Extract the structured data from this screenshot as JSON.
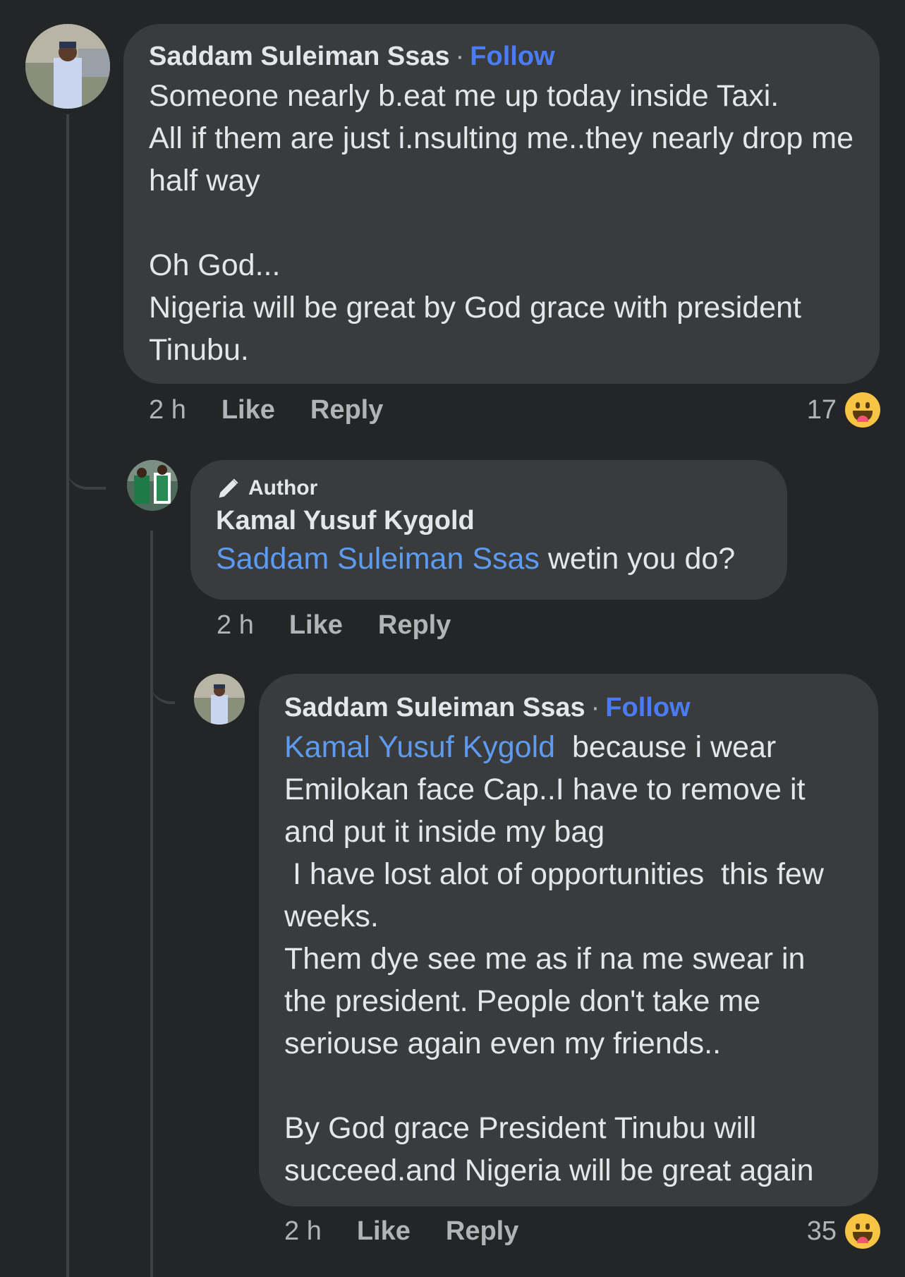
{
  "comments": [
    {
      "author": "Saddam Suleiman Ssas",
      "separator": "·",
      "follow_label": "Follow",
      "text": "Someone nearly b.eat me up today inside Taxi.\nAll if them are just i.nsulting me..they nearly drop me half way\n\nOh God...\nNigeria will be great by God grace with president Tinubu.",
      "time": "2 h",
      "like_label": "Like",
      "reply_label": "Reply",
      "reaction_count": "17",
      "reaction_icon": "laughing-emoji-icon"
    },
    {
      "badge_label": "Author",
      "badge_icon": "pencil-icon",
      "author": "Kamal Yusuf Kygold",
      "mention": "Saddam Suleiman Ssas",
      "text": " wetin you do?",
      "time": "2 h",
      "like_label": "Like",
      "reply_label": "Reply"
    },
    {
      "author": "Saddam Suleiman Ssas",
      "separator": "·",
      "follow_label": "Follow",
      "mention": "Kamal Yusuf Kygold",
      "text": "  because i wear Emilokan face Cap..I have to remove it and put it inside my bag\n I have lost alot of opportunities  this few weeks.\nThem dye see me as if na me swear in the president. People don't take me seriouse again even my friends..\n\nBy God grace President Tinubu will succeed.and Nigeria will be great again",
      "time": "2 h",
      "like_label": "Like",
      "reply_label": "Reply",
      "reaction_count": "35",
      "reaction_icon": "laughing-emoji-icon"
    }
  ],
  "colors": {
    "background": "#242526",
    "bubble": "#3a3b3c",
    "follow": "#4a7df5",
    "mention": "#5d9bf0"
  }
}
